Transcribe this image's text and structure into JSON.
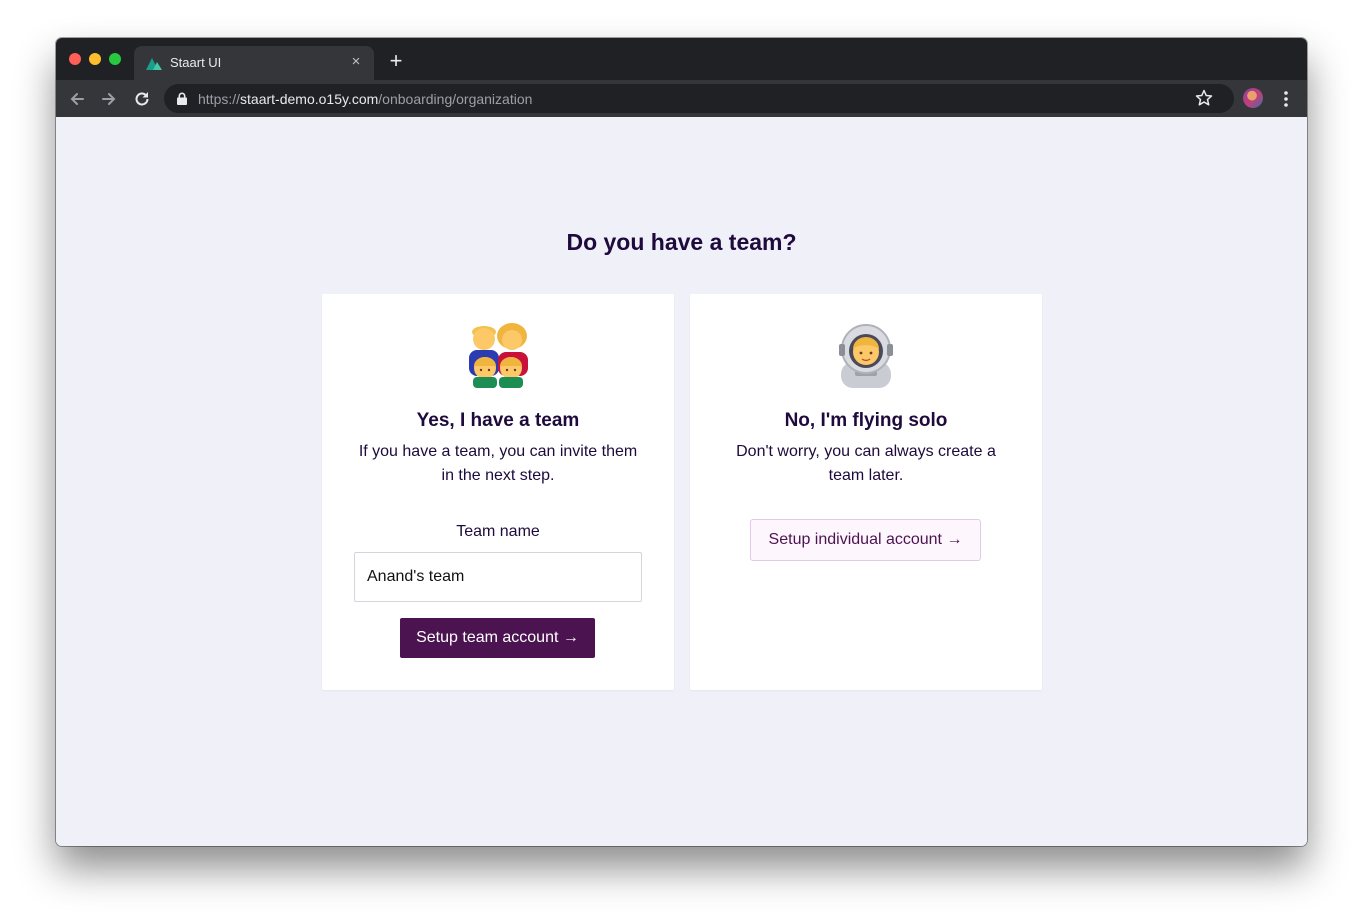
{
  "browser": {
    "tab_title": "Staart UI",
    "tab_close": "×",
    "new_tab": "+",
    "url_scheme": "https://",
    "url_host": "staart-demo.o15y.com",
    "url_path": "/onboarding/organization"
  },
  "page": {
    "heading": "Do you have a team?",
    "team_card": {
      "emoji": "👨‍👩‍👦‍👦",
      "title": "Yes, I have a team",
      "description": "If you have a team, you can invite them in the next step.",
      "field_label": "Team name",
      "input_value": "Anand's team",
      "button_label": "Setup team account →"
    },
    "solo_card": {
      "emoji": "👩‍🚀",
      "title": "No, I'm flying solo",
      "description": "Don't worry, you can always create a team later.",
      "button_label": "Setup individual account →"
    }
  },
  "colors": {
    "page_bg": "#f0f0f9",
    "text_dark": "#1e0a3c",
    "primary": "#4c1351"
  }
}
